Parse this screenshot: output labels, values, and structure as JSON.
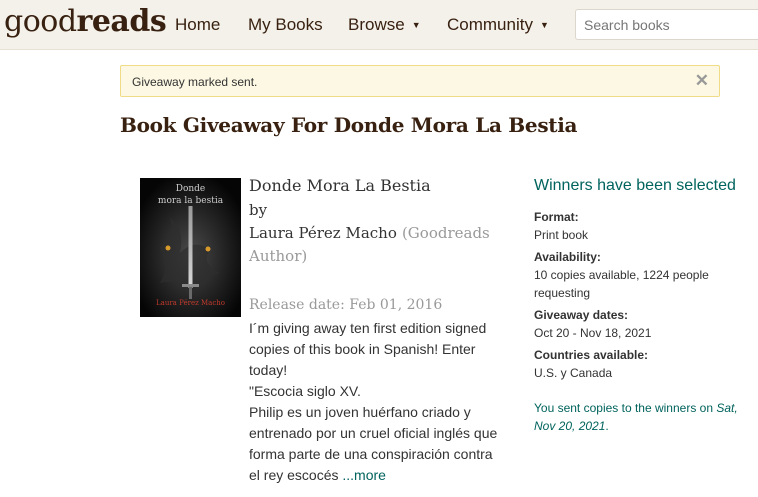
{
  "header": {
    "logo_light": "good",
    "logo_bold": "reads",
    "nav": [
      {
        "label": "Home"
      },
      {
        "label": "My Books"
      },
      {
        "label": "Browse",
        "caret": "▼"
      },
      {
        "label": "Community",
        "caret": "▼"
      }
    ],
    "search_placeholder": "Search books"
  },
  "flash": {
    "message": "Giveaway marked sent.",
    "close_glyph": "✕"
  },
  "page_title": "Book Giveaway For Donde Mora La Bestia",
  "book": {
    "cover_line1": "Donde",
    "cover_line2": "mora la bestia",
    "cover_author": "Laura Pérez Macho",
    "title": "Donde Mora La Bestia",
    "by": "by",
    "author": "Laura Pérez Macho",
    "author_role": "(Goodreads Author)",
    "release": "Release date: Feb 01, 2016",
    "description_lines": [
      "I´m giving away ten first edition signed",
      "copies of this book in Spanish! Enter",
      "today!",
      "\"Escocia siglo XV.",
      "Philip es un joven huérfano criado y",
      "entrenado por un cruel oficial inglés que",
      "forma parte de una conspiración contra",
      "el rey escocés "
    ],
    "more_label": "...more"
  },
  "giveaway": {
    "status": "Winners have been selected",
    "format_label": "Format:",
    "format_value": "Print book",
    "availability_label": "Availability:",
    "availability_value_line1": "10 copies available, 1224 people",
    "availability_value_line2": "requesting",
    "dates_label": "Giveaway dates:",
    "dates_value": "Oct 20 - Nov 18, 2021",
    "countries_label": "Countries available:",
    "countries_value": "U.S. y Canada",
    "sent_prefix": "You sent copies to the winners on",
    "sent_date_part1": "Sat,",
    "sent_date_part2": "Nov 20, 2021",
    "sent_suffix": "."
  },
  "colors": {
    "brand_dark": "#382110",
    "header_bg": "#f4f1ea",
    "link_green": "#00635d",
    "flash_bg": "#fcf8e3",
    "flash_border": "#f0dc86",
    "muted": "#999999"
  }
}
